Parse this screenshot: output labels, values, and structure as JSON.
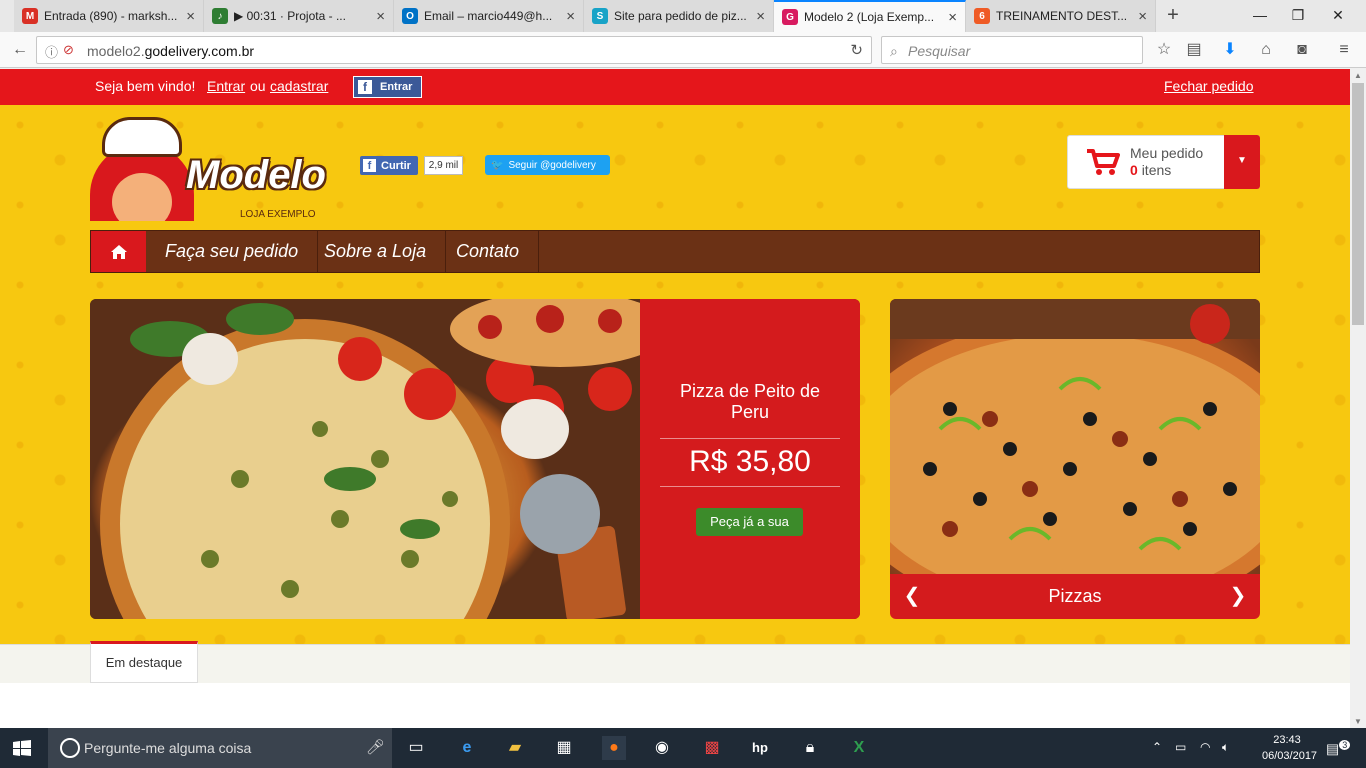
{
  "browser": {
    "tabs": [
      {
        "title": "Entrada (890) - marksh...",
        "favicon": "gmail-icon",
        "color": "#d93025",
        "glyph": "M"
      },
      {
        "title": "▶ 00:31 · Projota - ...",
        "favicon": "music-icon",
        "color": "#2e7d32",
        "glyph": "♪"
      },
      {
        "title": "Email – marcio449@h...",
        "favicon": "outlook-icon",
        "color": "#0072c6",
        "glyph": "O"
      },
      {
        "title": "Site para pedido de piz...",
        "favicon": "site-icon",
        "color": "#18a3c7",
        "glyph": "S"
      },
      {
        "title": "Modelo 2 (Loja Exemp...",
        "favicon": "godelivery-icon",
        "color": "#d81b60",
        "glyph": "G"
      },
      {
        "title": "TREINAMENTO DEST...",
        "favicon": "fire-icon",
        "color": "#ef5b25",
        "glyph": "6"
      }
    ],
    "url_prefix": "modelo2.",
    "url_domain": "godelivery.com.br",
    "search_placeholder": "Pesquisar"
  },
  "topbar": {
    "welcome": "Seja bem vindo!",
    "login": "Entrar",
    "or": "ou",
    "register": "cadastrar",
    "fb_login": "Entrar",
    "close_order": "Fechar pedido"
  },
  "brand": {
    "name": "Modelo",
    "subtitle": "LOJA EXEMPLO"
  },
  "social": {
    "like_label": "Curtir",
    "like_count": "2,9 mil",
    "twitter_label": "Seguir @godelivery"
  },
  "cart": {
    "title": "Meu pedido",
    "count": "0",
    "items_label": "itens"
  },
  "menu": {
    "items": [
      "Faça seu pedido",
      "Sobre a Loja",
      "Contato"
    ]
  },
  "slider": {
    "product_name": "Pizza de Peito de Peru",
    "price": "R$ 35,80",
    "cta": "Peça já a sua"
  },
  "side_carousel": {
    "label": "Pizzas"
  },
  "featured": {
    "tab_label": "Em destaque"
  },
  "taskbar": {
    "search_placeholder": "Pergunte-me alguma coisa",
    "time": "23:43",
    "date": "06/03/2017",
    "notifications": "3"
  },
  "colors": {
    "brand_red": "#e5161b",
    "brand_brown": "#6b3115",
    "brand_yellow": "#f7c810",
    "cta_green": "#3c8b2a"
  }
}
